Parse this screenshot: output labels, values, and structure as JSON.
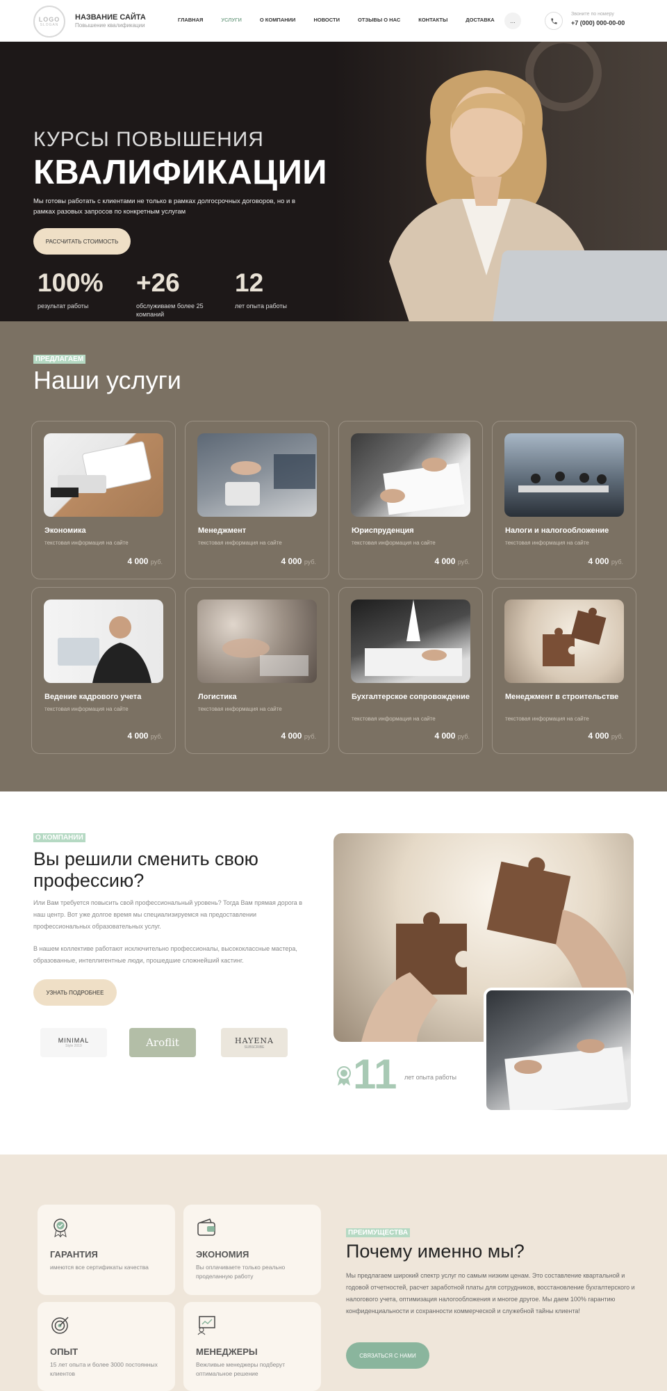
{
  "header": {
    "logo_main": "LOGO",
    "logo_sub": "SLOGAN",
    "site_name": "НАЗВАНИЕ САЙТА",
    "site_sub": "Повышение квалификации",
    "nav": [
      "ГЛАВНАЯ",
      "УСЛУГИ",
      "О КОМПАНИИ",
      "НОВОСТИ",
      "ОТЗЫВЫ О НАС",
      "КОНТАКТЫ",
      "ДОСТАВКА"
    ],
    "active_nav": "УСЛУГИ",
    "more": "...",
    "phone_label": "Звоните по номеру",
    "phone": "+7 (000) 000-00-00"
  },
  "hero": {
    "title_top": "КУРСЫ ПОВЫШЕНИЯ",
    "title_main": "КВАЛИФИКАЦИИ",
    "desc": "Мы готовы работать с клиентами не только в рамках долгосрочных договоров, но и в рамках разовых запросов по конкретным услугам",
    "cta": "РАССЧИТАТЬ СТОИМОСТЬ",
    "stats": [
      {
        "value": "100%",
        "label": "результат работы"
      },
      {
        "value": "+26",
        "label": "обслуживаем более 25 компаний"
      },
      {
        "value": "12",
        "label": "лет опыта работы"
      }
    ]
  },
  "services": {
    "tag": "ПРЕДЛАГАЕМ",
    "title": "Наши услуги",
    "items": [
      {
        "title": "Экономика",
        "sub": "текстовая информация на сайте",
        "price": "4 000",
        "unit": "руб."
      },
      {
        "title": "Менеджмент",
        "sub": "текстовая информация на сайте",
        "price": "4 000",
        "unit": "руб."
      },
      {
        "title": "Юриспруденция",
        "sub": "текстовая информация на сайте",
        "price": "4 000",
        "unit": "руб."
      },
      {
        "title": "Налоги и налогообложение",
        "sub": "текстовая информация на сайте",
        "price": "4 000",
        "unit": "руб."
      },
      {
        "title": "Ведение кадрового учета",
        "sub": "текстовая информация на сайте",
        "price": "4 000",
        "unit": "руб."
      },
      {
        "title": "Логистика",
        "sub": "текстовая информация на сайте",
        "price": "4 000",
        "unit": "руб."
      },
      {
        "title": "Бухгалтерское сопровождение",
        "sub": "текстовая информация на сайте",
        "price": "4 000",
        "unit": "руб."
      },
      {
        "title": "Менеджмент в строительстве",
        "sub": "текстовая информация на сайте",
        "price": "4 000",
        "unit": "руб."
      }
    ]
  },
  "about": {
    "tag": "О КОМПАНИИ",
    "title": "Вы решили сменить свою профессию?",
    "p1": "Или Вам требуется повысить свой профессиональный уровень? Тогда Вам прямая дорога в наш центр. Вот уже долгое время мы специализируемся на предоставлении профессиональных образовательных услуг.",
    "p2": "В нашем коллективе работают исключительно профессионалы, высококлассные мастера, образованные, интеллигентные люди, прошедшие сложнейший кастинг.",
    "cta": "УЗНАТЬ ПОДРОБНЕЕ",
    "brands": [
      {
        "name": "MINIMAL",
        "sub": "Style 2019"
      },
      {
        "name": "Aroflit",
        "sub": ""
      },
      {
        "name": "HAYENA",
        "sub": "SUBSCRIBE"
      }
    ],
    "years": "11",
    "years_label": "лет опыта работы"
  },
  "advantages": {
    "tag": "ПРЕИМУЩЕСТВА",
    "title": "Почему именно мы?",
    "desc": "Мы предлагаем широкий спектр услуг по самым низким ценам. Это составление квартальной и годовой отчетностей, расчет заработной платы для сотрудников, восстановление бухгалтерского и налогового учета, оптимизация налогообложения и многое другое. Мы даем 100% гарантию конфиденциальности и сохранности коммерческой и служебной тайны клиента!",
    "cta": "СВЯЗАТЬСЯ С НАМИ",
    "items": [
      {
        "title": "ГАРАНТИЯ",
        "desc": "имеются все сертификаты качества",
        "icon": "certificate-icon"
      },
      {
        "title": "ЭКОНОМИЯ",
        "desc": "Вы оплачиваете только реально проделанную работу",
        "icon": "wallet-icon"
      },
      {
        "title": "ОПЫТ",
        "desc": "15 лет опыта и более 3000 постоянных клиентов",
        "icon": "target-icon"
      },
      {
        "title": "МЕНЕДЖЕРЫ",
        "desc": "Вежливые менеджеры подберут оптимальное решение",
        "icon": "presentation-icon"
      }
    ]
  },
  "colors": {
    "accent": "#8ab59d",
    "cream": "#efdfc6",
    "brown": "#7b7163",
    "beige": "#efe6da"
  }
}
